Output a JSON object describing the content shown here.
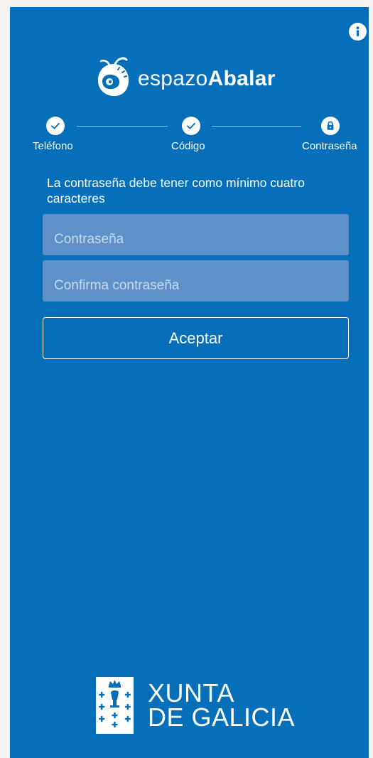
{
  "brand": {
    "prefix": "espazo",
    "name": "Abalar"
  },
  "header": {
    "info_icon": "info-icon"
  },
  "stepper": {
    "steps": [
      {
        "label": "Teléfono",
        "state": "done",
        "icon": "check-icon"
      },
      {
        "label": "Código",
        "state": "done",
        "icon": "check-icon"
      },
      {
        "label": "Contraseña",
        "state": "current",
        "icon": "lock-icon"
      }
    ]
  },
  "form": {
    "hint": "La contraseña debe tener como mínimo cuatro caracteres",
    "password_placeholder": "Contraseña",
    "password_value": "",
    "confirm_placeholder": "Confirma contraseña",
    "confirm_value": "",
    "accept_label": "Aceptar"
  },
  "footer": {
    "line1": "XUNTA",
    "line2": "DE GALICIA"
  },
  "colors": {
    "background": "#0570b9",
    "field": "#5e90c9",
    "text": "#ffffff"
  }
}
